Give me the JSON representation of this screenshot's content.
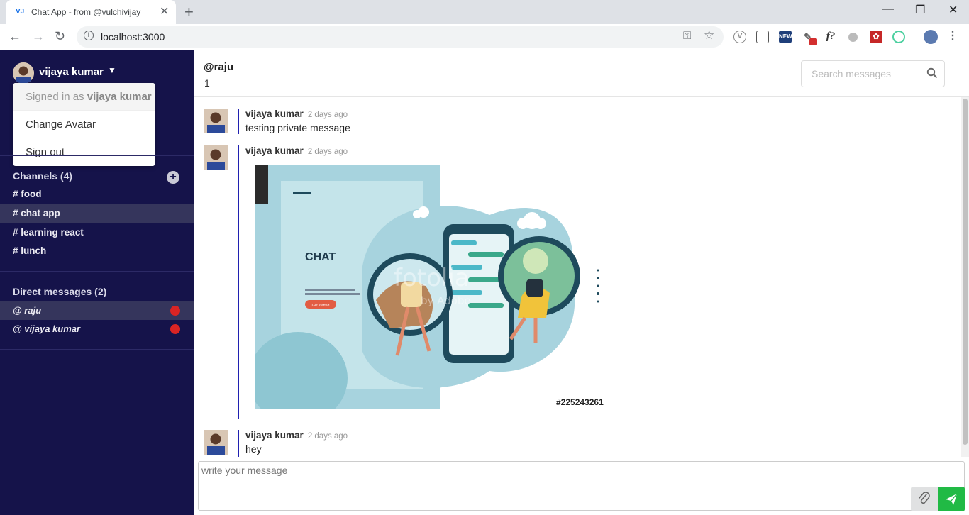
{
  "browser": {
    "tab_favicon": "VJ",
    "tab_title": "Chat App - from @vulchivijay",
    "url": "localhost:3000",
    "colors": {
      "tab_favicon": "#1a73e8"
    }
  },
  "sidebar": {
    "user_name": "vijaya kumar",
    "dropdown": {
      "signed_in_prefix": "Signed in as",
      "signed_in_name": "vijaya kumar",
      "items": [
        "Change Avatar",
        "Sign out"
      ]
    },
    "channels": {
      "title": "Channels (4)",
      "items": [
        {
          "label": "# food",
          "active": false
        },
        {
          "label": "# chat app",
          "active": true
        },
        {
          "label": "# learning react",
          "active": false
        },
        {
          "label": "# lunch",
          "active": false
        }
      ]
    },
    "direct_messages": {
      "title": "Direct messages (2)",
      "items": [
        {
          "label": "@ raju",
          "active": true
        },
        {
          "label": "@ vijaya kumar",
          "active": false
        }
      ]
    },
    "colors": {
      "background": "#15134a",
      "active_item": "#35355c",
      "status_dot": "#d92424"
    }
  },
  "header": {
    "title": "@raju",
    "count": "1",
    "search_placeholder": "Search messages"
  },
  "messages": [
    {
      "author": "vijaya kumar",
      "time": "2 days ago",
      "text": "testing private message"
    },
    {
      "author": "vijaya kumar",
      "time": "2 days ago",
      "image": {
        "heading": "CHAT",
        "button": "Get started",
        "watermark": "fotolia",
        "watermark_sub": "by Adobe",
        "caption": "#225243261"
      }
    },
    {
      "author": "vijaya kumar",
      "time": "2 days ago",
      "text": "hey"
    }
  ],
  "composer": {
    "placeholder": "write your message",
    "colors": {
      "send": "#21ba45"
    }
  }
}
